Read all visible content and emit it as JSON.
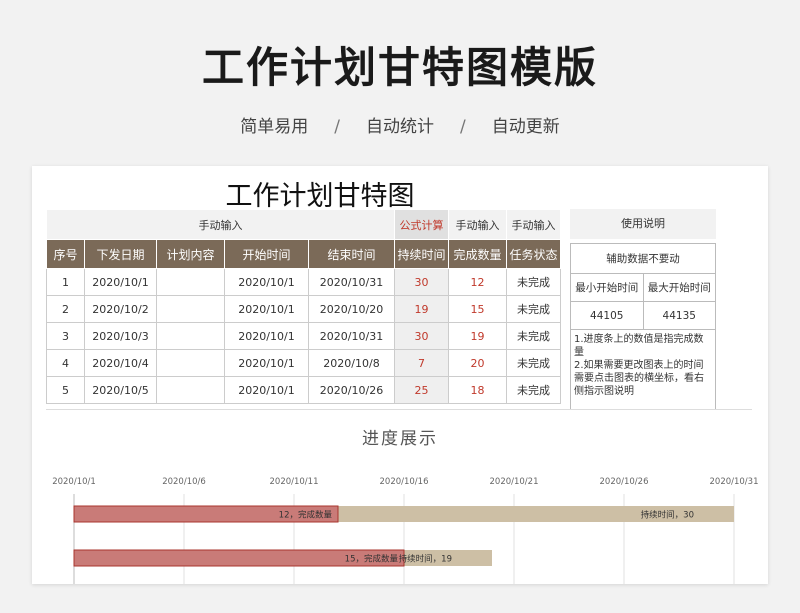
{
  "hero": {
    "title": "工作计划甘特图模版",
    "features": [
      "简单易用",
      "自动统计",
      "自动更新"
    ],
    "separator": "/"
  },
  "sheet": {
    "title": "工作计划甘特图",
    "groups": {
      "manual1": "手动输入",
      "formula": "公式计算",
      "manual2": "手动输入",
      "manual3": "手动输入"
    },
    "headers": [
      "序号",
      "下发日期",
      "计划内容",
      "开始时间",
      "结束时间",
      "持续时间",
      "完成数量",
      "任务状态"
    ],
    "rows": [
      {
        "no": "1",
        "issue": "2020/10/1",
        "content": "",
        "start": "2020/10/1",
        "end": "2020/10/31",
        "duration": "30",
        "done": "12",
        "status": "未完成"
      },
      {
        "no": "2",
        "issue": "2020/10/2",
        "content": "",
        "start": "2020/10/1",
        "end": "2020/10/20",
        "duration": "19",
        "done": "15",
        "status": "未完成"
      },
      {
        "no": "3",
        "issue": "2020/10/3",
        "content": "",
        "start": "2020/10/1",
        "end": "2020/10/31",
        "duration": "30",
        "done": "19",
        "status": "未完成"
      },
      {
        "no": "4",
        "issue": "2020/10/4",
        "content": "",
        "start": "2020/10/1",
        "end": "2020/10/8",
        "duration": "7",
        "done": "20",
        "status": "未完成"
      },
      {
        "no": "5",
        "issue": "2020/10/5",
        "content": "",
        "start": "2020/10/1",
        "end": "2020/10/26",
        "duration": "25",
        "done": "18",
        "status": "未完成"
      }
    ]
  },
  "helper": {
    "usage_label": "使用说明",
    "aux_title": "辅助数据不要动",
    "min_label": "最小开始时间",
    "max_label": "最大开始时间",
    "min_value": "44105",
    "max_value": "44135",
    "notes": [
      "1.进度条上的数值是指完成数量",
      "2.如果需要更改图表上的时间需要点击图表的横坐标，看右侧指示图说明"
    ]
  },
  "gantt": {
    "title": "进度展示"
  },
  "chart_data": {
    "type": "bar",
    "orientation": "horizontal-stacked",
    "title": "进度展示",
    "x_ticks": [
      "2020/10/1",
      "2020/10/6",
      "2020/10/11",
      "2020/10/16",
      "2020/10/21",
      "2020/10/26",
      "2020/10/31"
    ],
    "xlim": [
      "2020/10/1",
      "2020/10/31"
    ],
    "grid": true,
    "series": [
      {
        "name": "完成数量",
        "color": "#c97b78",
        "values": [
          12,
          15
        ]
      },
      {
        "name": "持续时间",
        "color": "#cdbfa5",
        "values": [
          30,
          19
        ]
      }
    ],
    "bar_labels": [
      {
        "done": "12，完成数量",
        "duration": "持续时间，30"
      },
      {
        "done": "15，完成数量",
        "duration": "持续时间，19"
      }
    ],
    "colors": {
      "done": "#c97b78",
      "done_border": "#a9342e",
      "duration": "#cdbfa5"
    }
  }
}
